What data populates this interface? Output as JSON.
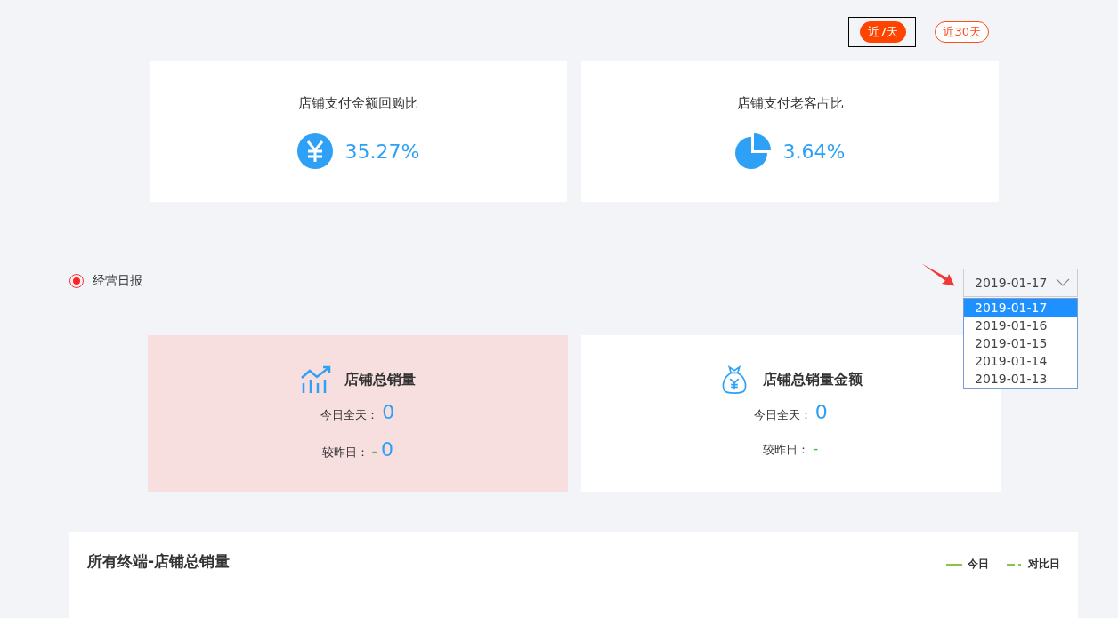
{
  "range_tabs": [
    {
      "label": "近7天",
      "selected": true
    },
    {
      "label": "近30天",
      "selected": false
    }
  ],
  "ratio_cards": [
    {
      "title": "店铺支付金额回购比",
      "kind": "yen",
      "value": "35.27%"
    },
    {
      "title": "店铺支付老客占比",
      "kind": "pie",
      "value": "3.64%"
    }
  ],
  "daily_report": {
    "label": "经营日报",
    "selected": true
  },
  "date_select": {
    "value": "2019-01-17",
    "expanded": true,
    "options": [
      {
        "label": "2019-01-17",
        "selected": true
      },
      {
        "label": "2019-01-16",
        "selected": false
      },
      {
        "label": "2019-01-15",
        "selected": false
      },
      {
        "label": "2019-01-14",
        "selected": false
      },
      {
        "label": "2019-01-13",
        "selected": false
      }
    ]
  },
  "sales_cards": [
    {
      "title": "店铺总销量",
      "kind": "chart",
      "selected": true,
      "today_label": "今日全天：",
      "today_value": "0",
      "compare_label": "较昨日：",
      "compare_sign": "-",
      "compare_value": "0"
    },
    {
      "title": "店铺总销量金额",
      "kind": "moneybag",
      "selected": false,
      "today_label": "今日全天：",
      "today_value": "0",
      "compare_label": "较昨日：",
      "compare_sign": "-"
    }
  ],
  "panel": {
    "title": "所有终端-店铺总销量",
    "legend": [
      {
        "label": "今日",
        "kind": "solid"
      },
      {
        "label": "对比日",
        "kind": "dashed"
      }
    ]
  }
}
